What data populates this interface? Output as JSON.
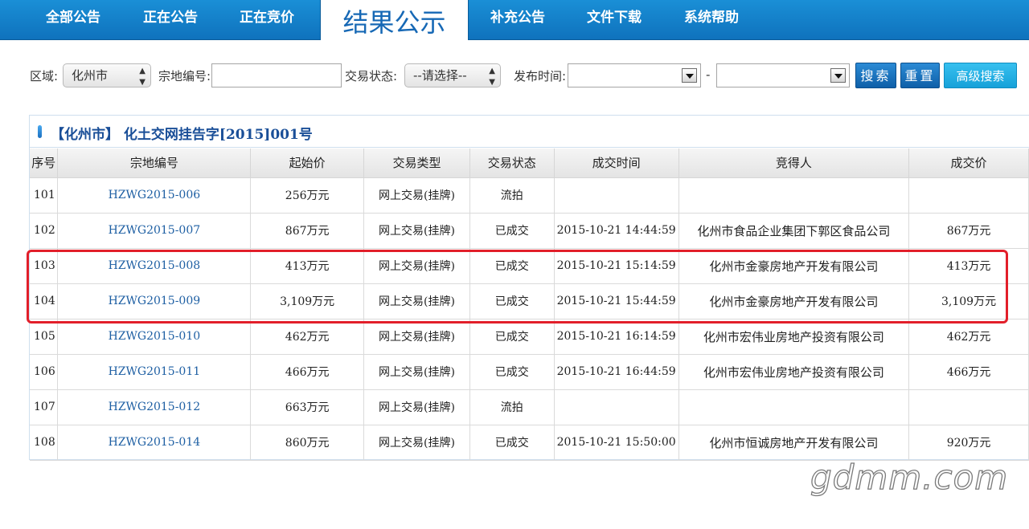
{
  "nav": {
    "items": [
      "全部公告",
      "正在公告",
      "正在竞价",
      "结果公示",
      "补充公告",
      "文件下载",
      "系统帮助"
    ],
    "active_index": 3
  },
  "filters": {
    "region_label": "区域:",
    "region_value": "化州市",
    "parcel_label": "宗地编号:",
    "parcel_value": "",
    "status_label": "交易状态:",
    "status_value": "--请选择--",
    "date_label": "发布时间:",
    "date_separator": "-",
    "search_label": "搜索",
    "reset_label": "重置",
    "advanced_label": "高级搜索"
  },
  "panel": {
    "title": "【化州市】 化土交网挂告字[2015]001号"
  },
  "table": {
    "headers": [
      "序号",
      "宗地编号",
      "起始价",
      "交易类型",
      "交易状态",
      "成交时间",
      "竞得人",
      "成交价"
    ],
    "rows": [
      [
        "101",
        "HZWG2015-006",
        "256万元",
        "网上交易(挂牌)",
        "流拍",
        "",
        "",
        ""
      ],
      [
        "102",
        "HZWG2015-007",
        "867万元",
        "网上交易(挂牌)",
        "已成交",
        "2015-10-21 14:44:59",
        "化州市食品企业集团下郭区食品公司",
        "867万元"
      ],
      [
        "103",
        "HZWG2015-008",
        "413万元",
        "网上交易(挂牌)",
        "已成交",
        "2015-10-21 15:14:59",
        "化州市金豪房地产开发有限公司",
        "413万元"
      ],
      [
        "104",
        "HZWG2015-009",
        "3,109万元",
        "网上交易(挂牌)",
        "已成交",
        "2015-10-21 15:44:59",
        "化州市金豪房地产开发有限公司",
        "3,109万元"
      ],
      [
        "105",
        "HZWG2015-010",
        "462万元",
        "网上交易(挂牌)",
        "已成交",
        "2015-10-21 16:14:59",
        "化州市宏伟业房地产投资有限公司",
        "462万元"
      ],
      [
        "106",
        "HZWG2015-011",
        "466万元",
        "网上交易(挂牌)",
        "已成交",
        "2015-10-21 16:44:59",
        "化州市宏伟业房地产投资有限公司",
        "466万元"
      ],
      [
        "107",
        "HZWG2015-012",
        "663万元",
        "网上交易(挂牌)",
        "流拍",
        "",
        "",
        ""
      ],
      [
        "108",
        "HZWG2015-014",
        "860万元",
        "网上交易(挂牌)",
        "已成交",
        "2015-10-21 15:50:00",
        "化州市恒诚房地产开发有限公司",
        "920万元"
      ]
    ]
  },
  "watermark": "gdmm.com",
  "colors": {
    "nav_bg": "#1580c9",
    "link": "#1e5fa3",
    "title": "#1a4f98",
    "highlight": "#e21f2a"
  }
}
